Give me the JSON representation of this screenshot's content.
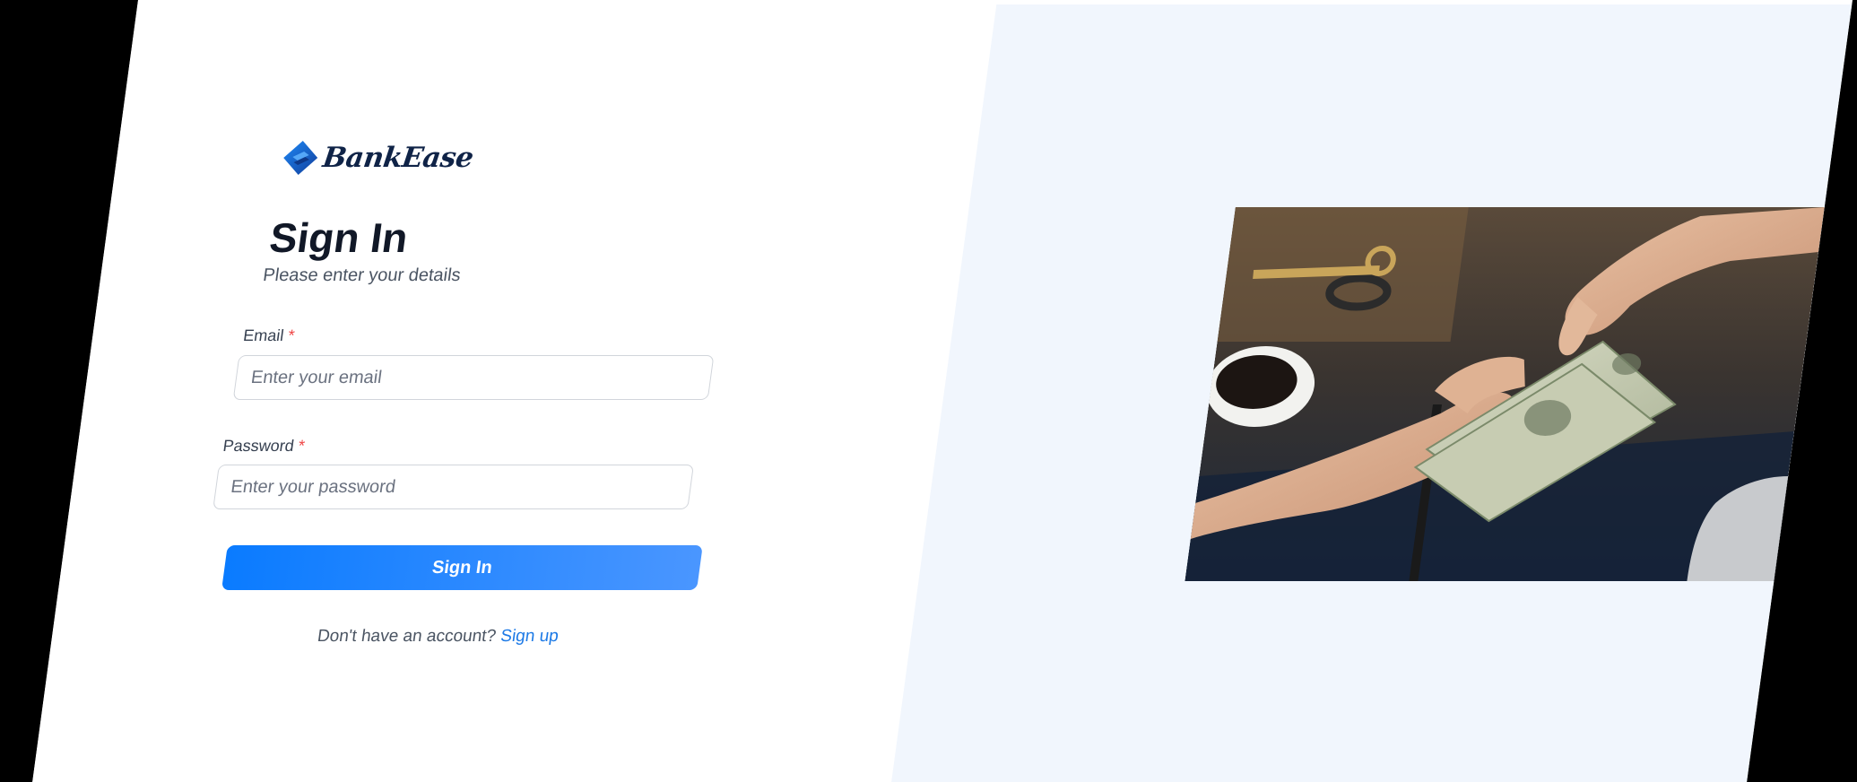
{
  "brand": {
    "name": "BankEase",
    "logo_icon": "bank-logo-icon",
    "accent": "#1f5fd0"
  },
  "signin": {
    "title": "Sign In",
    "subtitle": "Please enter your details",
    "email": {
      "label": "Email",
      "required_marker": "*",
      "placeholder": "Enter your email",
      "value": ""
    },
    "password": {
      "label": "Password",
      "required_marker": "*",
      "placeholder": "Enter your password",
      "value": ""
    },
    "submit_label": "Sign In",
    "signup_prompt": "Don't have an account?",
    "signup_link": "Sign up"
  },
  "hero_image": {
    "icon": "cash-handoff-photo"
  },
  "colors": {
    "button_start": "#0a7bff",
    "button_end": "#4a96ff",
    "right_panel_bg": "#f1f6fd",
    "required": "#ef4444",
    "link": "#1d7ae6"
  }
}
